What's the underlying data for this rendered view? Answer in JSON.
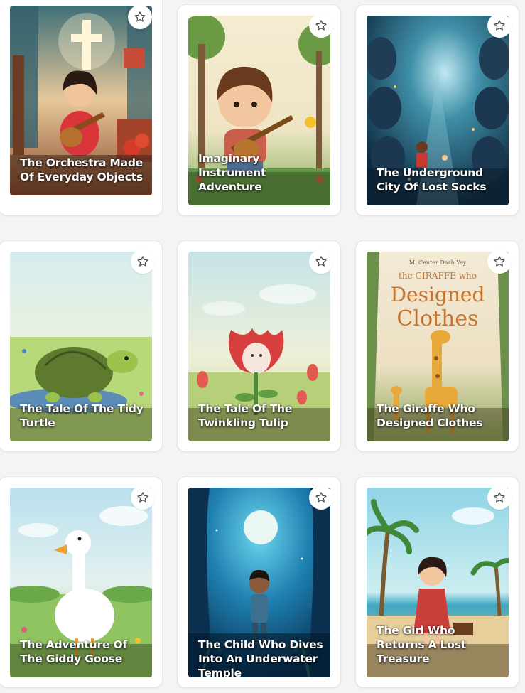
{
  "books": [
    {
      "title": "The Orchestra Made Of Everyday Objects"
    },
    {
      "title": "Imaginary Instrument Adventure"
    },
    {
      "title": "The Underground City Of Lost Socks"
    },
    {
      "title": "The Tale Of The Tidy Turtle"
    },
    {
      "title": "The Tale Of The Twinkling Tulip"
    },
    {
      "title": "The Giraffe Who Designed Clothes",
      "cover_text": {
        "author": "M. Center Dash Yey",
        "line1": "the GIRAFFE who",
        "line2": "Designed",
        "line3": "Clothes"
      }
    },
    {
      "title": "The Adventure Of The Giddy Goose"
    },
    {
      "title": "The Child Who Dives Into An Underwater Temple"
    },
    {
      "title": "The Girl Who Returns A Lost Treasure"
    }
  ],
  "icons": {
    "favorite": "star-outline-icon"
  },
  "colors": {
    "card_bg": "#ffffff",
    "page_bg": "#f4f4f6",
    "title_text": "#ffffff"
  }
}
